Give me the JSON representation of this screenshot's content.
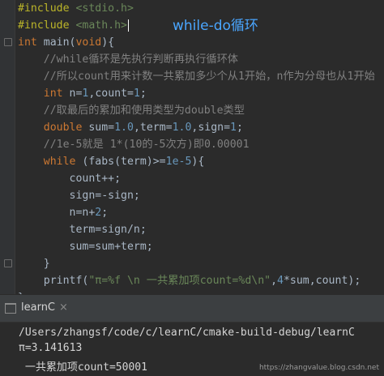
{
  "editor": {
    "title_overlay": "while-do循环",
    "lines": [
      {
        "parts": [
          {
            "t": "#include",
            "c": "dir"
          },
          {
            "t": " "
          },
          {
            "t": "<stdio.h>",
            "c": "str"
          }
        ]
      },
      {
        "parts": [
          {
            "t": "#include",
            "c": "dir"
          },
          {
            "t": " "
          },
          {
            "t": "<math.h>",
            "c": "str"
          }
        ],
        "caret": true
      },
      {
        "parts": [
          {
            "t": "int",
            "c": "kw"
          },
          {
            "t": " main("
          },
          {
            "t": "void",
            "c": "kw"
          },
          {
            "t": "){"
          }
        ]
      },
      {
        "parts": [
          {
            "t": "    "
          },
          {
            "t": "//while循环是先执行判断再执行循环体",
            "c": "cmt"
          }
        ]
      },
      {
        "parts": [
          {
            "t": "    "
          },
          {
            "t": "//所以count用来计数一共累加多少个从1开始，n作为分母也从1开始",
            "c": "cmt"
          }
        ]
      },
      {
        "parts": [
          {
            "t": "    "
          },
          {
            "t": "int",
            "c": "kw"
          },
          {
            "t": " n="
          },
          {
            "t": "1",
            "c": "num"
          },
          {
            "t": ",count="
          },
          {
            "t": "1",
            "c": "num"
          },
          {
            "t": ";"
          }
        ]
      },
      {
        "parts": [
          {
            "t": "    "
          },
          {
            "t": "//取最后的累加和使用类型为double类型",
            "c": "cmt"
          }
        ]
      },
      {
        "parts": [
          {
            "t": "    "
          },
          {
            "t": "double",
            "c": "kw"
          },
          {
            "t": " sum="
          },
          {
            "t": "1.0",
            "c": "num"
          },
          {
            "t": ",term="
          },
          {
            "t": "1.0",
            "c": "num"
          },
          {
            "t": ",sign="
          },
          {
            "t": "1",
            "c": "num"
          },
          {
            "t": ";"
          }
        ]
      },
      {
        "parts": [
          {
            "t": "    "
          },
          {
            "t": "//1e-5就是 1*(10的-5次方)即0.00001",
            "c": "cmt"
          }
        ]
      },
      {
        "parts": [
          {
            "t": "    "
          },
          {
            "t": "while",
            "c": "kw"
          },
          {
            "t": " (fabs(term)>="
          },
          {
            "t": "1e-5",
            "c": "num"
          },
          {
            "t": "){"
          }
        ]
      },
      {
        "parts": [
          {
            "t": "        count++;"
          }
        ]
      },
      {
        "parts": [
          {
            "t": "        sign=-sign;"
          }
        ]
      },
      {
        "parts": [
          {
            "t": "        n=n+"
          },
          {
            "t": "2",
            "c": "num"
          },
          {
            "t": ";"
          }
        ]
      },
      {
        "parts": [
          {
            "t": "        term=sign/n;"
          }
        ]
      },
      {
        "parts": [
          {
            "t": "        sum=sum+term;"
          }
        ]
      },
      {
        "parts": [
          {
            "t": "    }"
          }
        ]
      },
      {
        "parts": [
          {
            "t": "    printf("
          },
          {
            "t": "\"π=%f \\n 一共累加项count=%d\\n\"",
            "c": "str"
          },
          {
            "t": ","
          },
          {
            "t": "4",
            "c": "num"
          },
          {
            "t": "*sum,count);"
          }
        ]
      },
      {
        "parts": [
          {
            "t": "}"
          }
        ]
      }
    ]
  },
  "run": {
    "tab_label": "learnC",
    "tab_close": "×",
    "output": [
      "/Users/zhangsf/code/c/learnC/cmake-build-debug/learnC",
      "π=3.141613",
      " 一共累加项count=50001"
    ],
    "watermark": "https://zhangvalue.blog.csdn.net"
  }
}
